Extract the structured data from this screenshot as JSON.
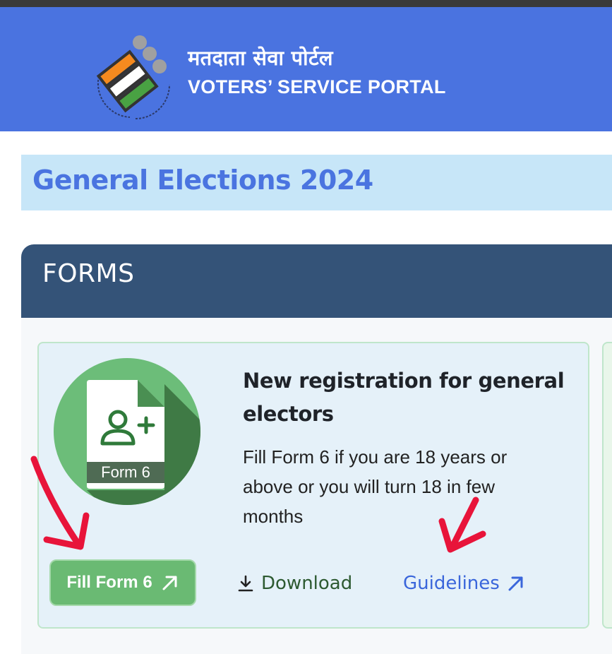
{
  "header": {
    "title_hindi": "मतदाता सेवा पोर्टल",
    "title_english": "VOTERS’ SERVICE PORTAL",
    "logo_icon": "eci-logo"
  },
  "banner": {
    "title": "General Elections 2024"
  },
  "forms": {
    "heading": "FORMS",
    "card": {
      "icon_label": "Form 6",
      "icon_name": "add-user-document-icon",
      "title": "New registration for general electors",
      "description": "Fill Form 6 if you are 18 years or above or you will turn 18 in few months",
      "fill_button": "Fill Form 6",
      "download_link": "Download",
      "guidelines_link": "Guidelines"
    }
  },
  "colors": {
    "header_bg": "#4a73e0",
    "banner_bg": "#c7e6f8",
    "forms_header_bg": "#345378",
    "button_green": "#6aba73",
    "link_blue": "#3a66db",
    "annotation_red": "#e8143a"
  }
}
